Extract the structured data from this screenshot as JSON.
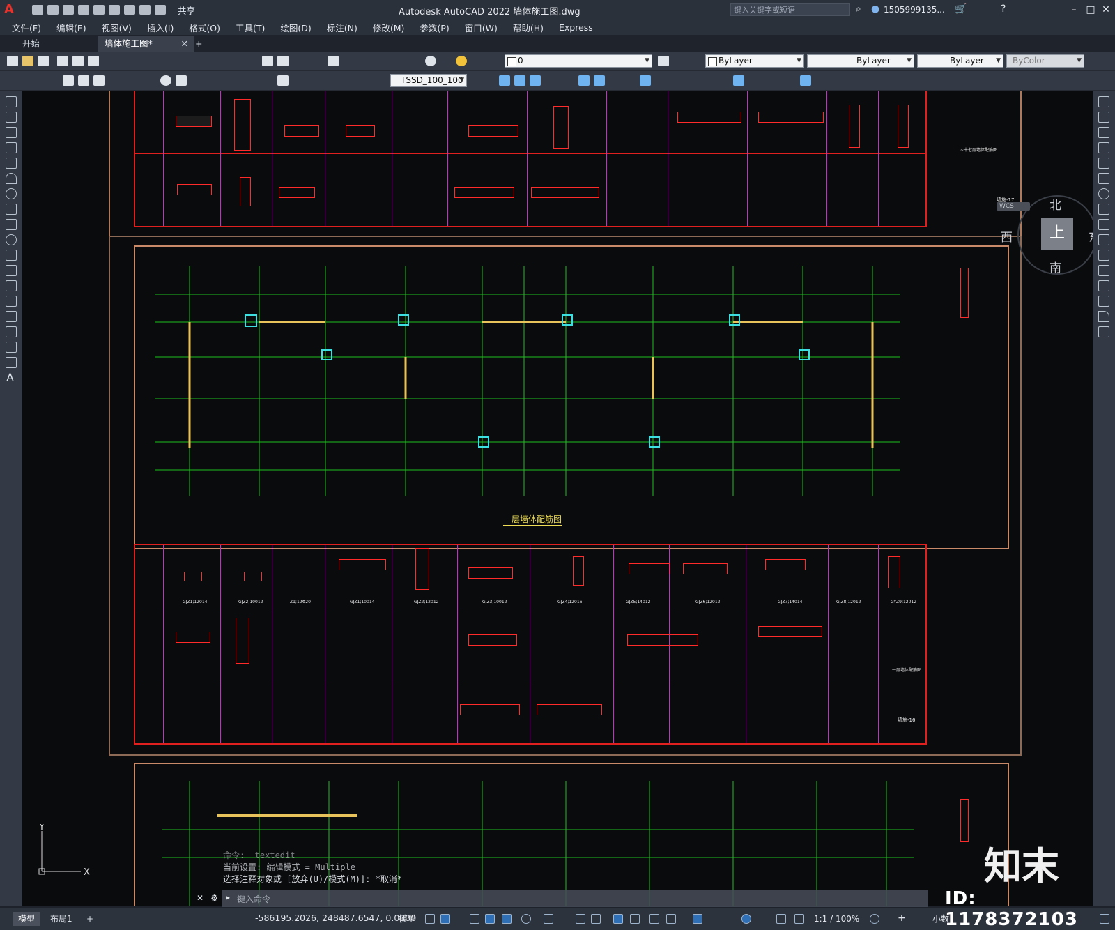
{
  "app": {
    "title": "Autodesk AutoCAD 2022    墙体施工图.dwg",
    "search_placeholder": "键入关键字或短语",
    "user": "1505999135...",
    "share": "共享"
  },
  "menu": [
    "文件(F)",
    "编辑(E)",
    "视图(V)",
    "插入(I)",
    "格式(O)",
    "工具(T)",
    "绘图(D)",
    "标注(N)",
    "修改(M)",
    "参数(P)",
    "窗口(W)",
    "帮助(H)",
    "Express"
  ],
  "tabs": {
    "start": "开始",
    "active": "墙体施工图*",
    "plus": "+"
  },
  "properties": {
    "layer": "0",
    "color": "ByLayer",
    "linetype": "ByLayer",
    "lineweight": "ByLayer",
    "plotstyle": "ByColor",
    "dimstyle": "TSSD_100_100"
  },
  "viewcube": {
    "north": "北",
    "south": "南",
    "east": "东",
    "west": "西",
    "top": "上",
    "wcs": "WCS"
  },
  "drawing": {
    "plan_title": "一层墙体配筋图",
    "sheet_label_mid": "墙施-16",
    "sheet_label_top": "墙施-17",
    "side_note_top": "二~十七层墙体配筋图",
    "side_note_mid": "一层墙体配筋图",
    "section_captions": [
      "GJZ1;12014",
      "GJZ2;10012",
      "Z1;12Φ20",
      "GJZ1;10014",
      "GJZ2;12012",
      "GJZ3;10012",
      "GJZ4;12016",
      "GJZ5;14012",
      "GJZ6;12012",
      "GJZ7;14014",
      "GJZ8;12012",
      "GYZ9;12012"
    ]
  },
  "command": {
    "history": [
      "命令: _textedit",
      "当前设置: 编辑模式 = Multiple",
      "选择注释对象或 [放弃(U)/模式(M)]: *取消*"
    ],
    "placeholder": "键入命令"
  },
  "status": {
    "model_tab": "模型",
    "layout_tab": "布局1",
    "plus": "+",
    "coords": "-586195.2026, 248487.6547, 0.0000",
    "mode": "模型",
    "scale": "1:1 / 100%",
    "units": "小数"
  },
  "watermark": {
    "brand": "知末",
    "id": "ID: 1178372103"
  }
}
